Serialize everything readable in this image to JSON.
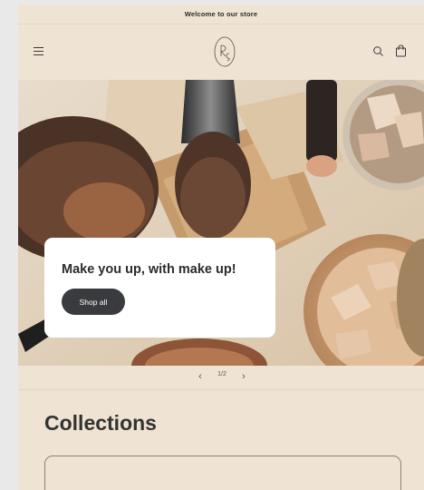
{
  "announcement": {
    "text": "Welcome to our store"
  },
  "header": {
    "menu_icon": "hamburger-menu-icon",
    "logo_icon": "brand-logo-monogram",
    "search_icon": "search-icon",
    "cart_icon": "shopping-bag-icon"
  },
  "hero": {
    "heading": "Make you up, with make up!",
    "button_label": "Shop all"
  },
  "slider": {
    "prev_icon": "chevron-left-icon",
    "prev_glyph": "‹",
    "counter": "1/2",
    "next_icon": "chevron-right-icon",
    "next_glyph": "›"
  },
  "collections": {
    "title": "Collections"
  },
  "colors": {
    "page_bg": "#efe4d3",
    "button_dark": "#3a3b3e",
    "card_bg": "#ffffff"
  }
}
